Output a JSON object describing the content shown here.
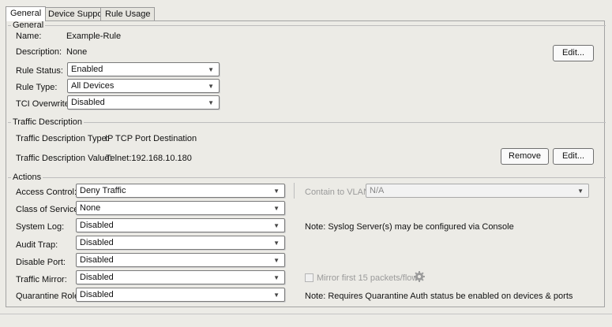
{
  "tabs": [
    {
      "label": "General",
      "active": true
    },
    {
      "label": "Device Support",
      "active": false
    },
    {
      "label": "Rule Usage",
      "active": false
    }
  ],
  "general": {
    "legend": "General",
    "name_label": "Name:",
    "name_value": "Example-Rule",
    "description_label": "Description:",
    "description_value": "None",
    "edit_button": "Edit...",
    "rule_status_label": "Rule Status:",
    "rule_status_value": "Enabled",
    "rule_type_label": "Rule Type:",
    "rule_type_value": "All Devices",
    "tci_overwrite_label": "TCI Overwrite:",
    "tci_overwrite_value": "Disabled"
  },
  "traffic": {
    "legend": "Traffic Description",
    "type_label": "Traffic Description Type:",
    "type_value": "IP TCP Port Destination",
    "value_label": "Traffic Description Value:",
    "value_value": "Telnet:192.168.10.180",
    "remove_button": "Remove",
    "edit_button": "Edit..."
  },
  "actions": {
    "legend": "Actions",
    "access_control_label": "Access Control:",
    "access_control_value": "Deny Traffic",
    "contain_vlan_label": "Contain to VLAN:",
    "contain_vlan_value": "N/A",
    "class_of_service_label": "Class of Service:",
    "class_of_service_value": "None",
    "system_log_label": "System Log:",
    "system_log_value": "Disabled",
    "syslog_note": "Note: Syslog Server(s) may be configured via Console",
    "audit_trap_label": "Audit Trap:",
    "audit_trap_value": "Disabled",
    "disable_port_label": "Disable Port:",
    "disable_port_value": "Disabled",
    "traffic_mirror_label": "Traffic Mirror:",
    "traffic_mirror_value": "Disabled",
    "mirror_checkbox_label": "Mirror first 15 packets/flow",
    "quarantine_role_label": "Quarantine Role:",
    "quarantine_role_value": "Disabled",
    "quarantine_note": "Note: Requires Quarantine Auth status be enabled on devices & ports"
  },
  "icons": {
    "dropdown_arrow": "chevron-down-icon",
    "settings": "gear-icon"
  },
  "colors": {
    "window_background": "#ecebe6",
    "field_background": "#ffffff",
    "border": "#7a7a7a"
  }
}
